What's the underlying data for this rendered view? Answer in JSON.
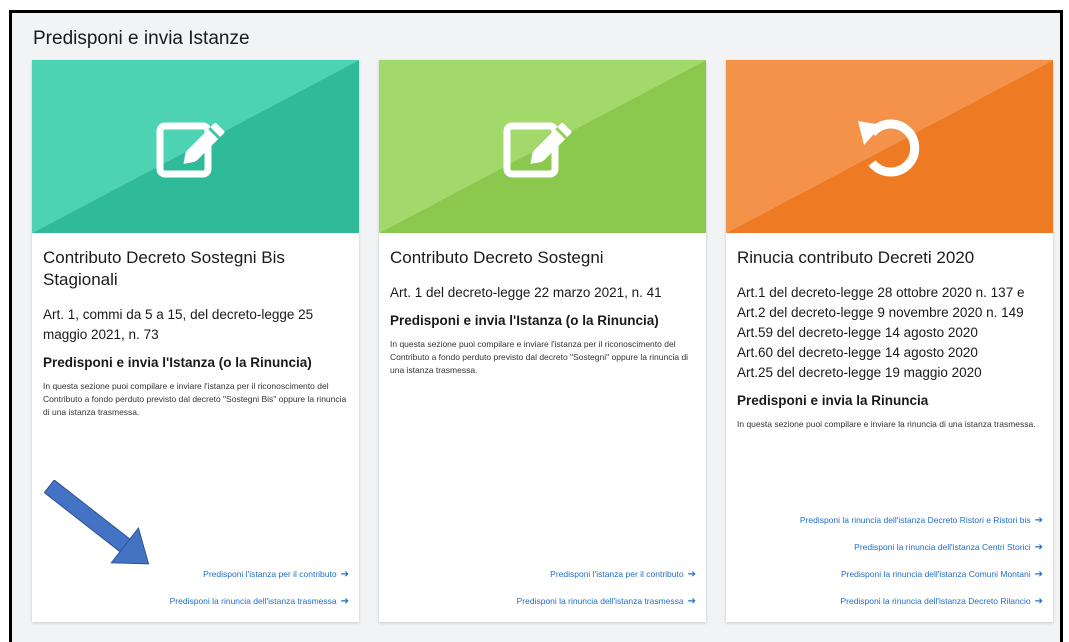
{
  "section": {
    "title": "Predisponi e invia Istanze"
  },
  "cards": [
    {
      "icon": "edit-icon",
      "color_light": "#4dd2b4",
      "color_dark": "#2fbb9a",
      "title": "Contributo Decreto Sostegni Bis Stagionali",
      "refs": [
        "Art. 1, commi da 5 a 15, del decreto-legge 25 maggio 2021, n. 73"
      ],
      "action": "Predisponi e invia l'Istanza (o la Rinuncia)",
      "description": "In questa sezione puoi compilare e inviare l'istanza per il riconoscimento del Contributo a fondo perduto previsto dal decreto \"Sostegni Bis\" oppure la rinuncia di una istanza trasmessa.",
      "links": [
        "Predisponi l'istanza per il contributo",
        "Predisponi la rinuncia dell'istanza trasmessa"
      ]
    },
    {
      "icon": "edit-icon",
      "color_light": "#a3d86a",
      "color_dark": "#8ac84e",
      "title": "Contributo Decreto Sostegni",
      "refs": [
        "Art. 1 del decreto-legge 22 marzo 2021, n. 41"
      ],
      "action": "Predisponi e invia l'Istanza (o la Rinuncia)",
      "description": "In questa sezione puoi compilare e inviare l'istanza per il riconoscimento del Contributo a fondo perduto previsto dal decreto \"Sostegni\" oppure la rinuncia di una istanza trasmessa.",
      "links": [
        "Predisponi l'istanza per il contributo",
        "Predisponi la rinuncia dell'istanza trasmessa"
      ]
    },
    {
      "icon": "undo-icon",
      "color_light": "#f4924a",
      "color_dark": "#ee7a24",
      "title": "Rinucia contributo Decreti 2020",
      "refs": [
        "Art.1 del decreto-legge 28 ottobre 2020 n. 137 e Art.2 del decreto-legge 9 novembre 2020 n. 149",
        "Art.59 del decreto-legge 14 agosto 2020",
        "Art.60 del decreto-legge 14 agosto 2020",
        "Art.25 del decreto-legge 19 maggio 2020"
      ],
      "action": "Predisponi e invia la Rinuncia",
      "description": "In questa sezione puoi compilare e inviare la rinuncia di una istanza trasmessa.",
      "links": [
        "Predisponi la rinuncia dell'istanza Decreto Ristori e Ristori bis",
        "Predisponi la rinuncia dell'istanza Centri Storici",
        "Predisponi la rinuncia dell'istanza Comuni Montani",
        "Predisponi la rinuncia dell'istanza Decreto Rilancio"
      ]
    }
  ],
  "annotation": {
    "arrow_color": "#4472c4"
  }
}
